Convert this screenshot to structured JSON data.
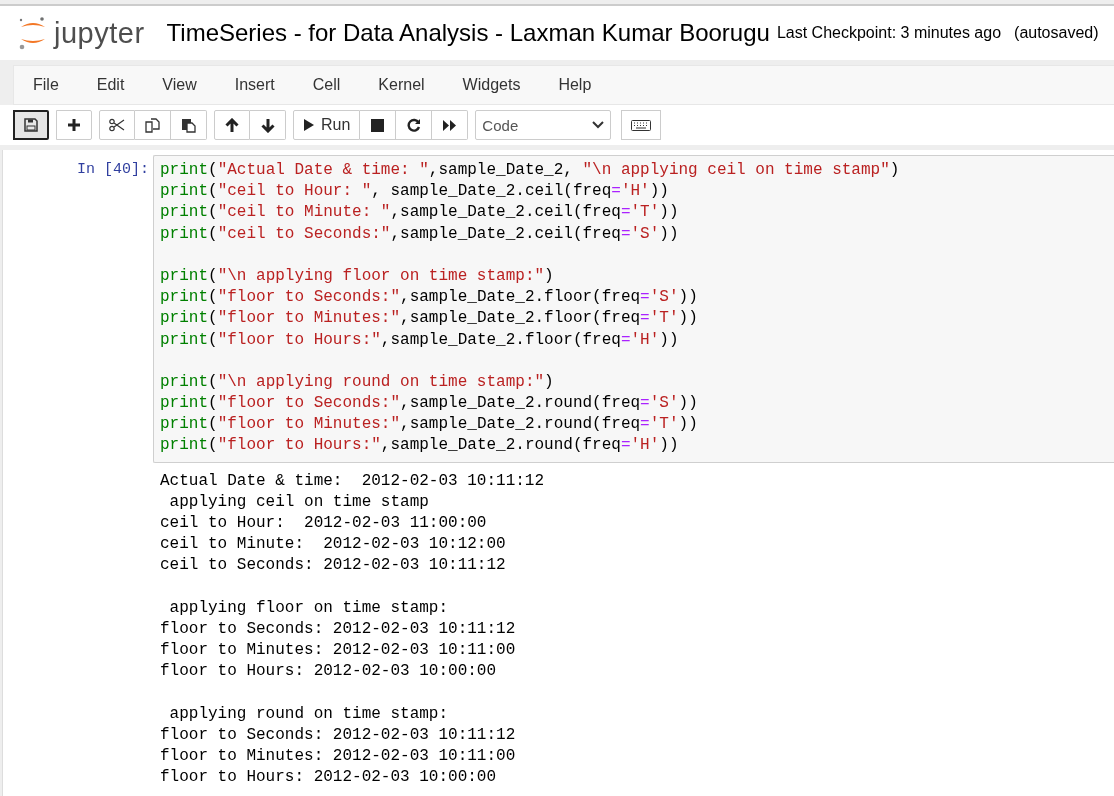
{
  "header": {
    "logo_text": "jupyter",
    "notebook_title": "TimeSeries - for Data Analysis - Laxman Kumar Boorugu",
    "checkpoint": "Last Checkpoint: 3 minutes ago",
    "autosave": "(autosaved)"
  },
  "menu": [
    "File",
    "Edit",
    "View",
    "Insert",
    "Cell",
    "Kernel",
    "Widgets",
    "Help"
  ],
  "toolbar": {
    "run_label": "Run",
    "cell_type": "Code"
  },
  "cell": {
    "prompt": "In [40]:",
    "code_blocks": [
      [
        [
          {
            "kind": "builtin",
            "text": "print"
          },
          {
            "kind": "plain",
            "text": "("
          },
          {
            "kind": "string",
            "text": "\"Actual Date & time: \""
          },
          {
            "kind": "plain",
            "text": ",sample_Date_2, "
          },
          {
            "kind": "string",
            "text": "\"\\n applying ceil on time stamp\""
          },
          {
            "kind": "plain",
            "text": ")"
          }
        ],
        [
          {
            "kind": "builtin",
            "text": "print"
          },
          {
            "kind": "plain",
            "text": "("
          },
          {
            "kind": "string",
            "text": "\"ceil to Hour: \""
          },
          {
            "kind": "plain",
            "text": ", sample_Date_2.ceil(freq"
          },
          {
            "kind": "op",
            "text": "="
          },
          {
            "kind": "string",
            "text": "'H'"
          },
          {
            "kind": "plain",
            "text": "))"
          }
        ],
        [
          {
            "kind": "builtin",
            "text": "print"
          },
          {
            "kind": "plain",
            "text": "("
          },
          {
            "kind": "string",
            "text": "\"ceil to Minute: \""
          },
          {
            "kind": "plain",
            "text": ",sample_Date_2.ceil(freq"
          },
          {
            "kind": "op",
            "text": "="
          },
          {
            "kind": "string",
            "text": "'T'"
          },
          {
            "kind": "plain",
            "text": "))"
          }
        ],
        [
          {
            "kind": "builtin",
            "text": "print"
          },
          {
            "kind": "plain",
            "text": "("
          },
          {
            "kind": "string",
            "text": "\"ceil to Seconds:\""
          },
          {
            "kind": "plain",
            "text": ",sample_Date_2.ceil(freq"
          },
          {
            "kind": "op",
            "text": "="
          },
          {
            "kind": "string",
            "text": "'S'"
          },
          {
            "kind": "plain",
            "text": "))"
          }
        ]
      ],
      [
        [
          {
            "kind": "builtin",
            "text": "print"
          },
          {
            "kind": "plain",
            "text": "("
          },
          {
            "kind": "string",
            "text": "\"\\n applying floor on time stamp:\""
          },
          {
            "kind": "plain",
            "text": ")"
          }
        ],
        [
          {
            "kind": "builtin",
            "text": "print"
          },
          {
            "kind": "plain",
            "text": "("
          },
          {
            "kind": "string",
            "text": "\"floor to Seconds:\""
          },
          {
            "kind": "plain",
            "text": ",sample_Date_2.floor(freq"
          },
          {
            "kind": "op",
            "text": "="
          },
          {
            "kind": "string",
            "text": "'S'"
          },
          {
            "kind": "plain",
            "text": "))"
          }
        ],
        [
          {
            "kind": "builtin",
            "text": "print"
          },
          {
            "kind": "plain",
            "text": "("
          },
          {
            "kind": "string",
            "text": "\"floor to Minutes:\""
          },
          {
            "kind": "plain",
            "text": ",sample_Date_2.floor(freq"
          },
          {
            "kind": "op",
            "text": "="
          },
          {
            "kind": "string",
            "text": "'T'"
          },
          {
            "kind": "plain",
            "text": "))"
          }
        ],
        [
          {
            "kind": "builtin",
            "text": "print"
          },
          {
            "kind": "plain",
            "text": "("
          },
          {
            "kind": "string",
            "text": "\"floor to Hours:\""
          },
          {
            "kind": "plain",
            "text": ",sample_Date_2.floor(freq"
          },
          {
            "kind": "op",
            "text": "="
          },
          {
            "kind": "string",
            "text": "'H'"
          },
          {
            "kind": "plain",
            "text": "))"
          }
        ]
      ],
      [
        [
          {
            "kind": "builtin",
            "text": "print"
          },
          {
            "kind": "plain",
            "text": "("
          },
          {
            "kind": "string",
            "text": "\"\\n applying round on time stamp:\""
          },
          {
            "kind": "plain",
            "text": ")"
          }
        ],
        [
          {
            "kind": "builtin",
            "text": "print"
          },
          {
            "kind": "plain",
            "text": "("
          },
          {
            "kind": "string",
            "text": "\"floor to Seconds:\""
          },
          {
            "kind": "plain",
            "text": ",sample_Date_2.round(freq"
          },
          {
            "kind": "op",
            "text": "="
          },
          {
            "kind": "string",
            "text": "'S'"
          },
          {
            "kind": "plain",
            "text": "))"
          }
        ],
        [
          {
            "kind": "builtin",
            "text": "print"
          },
          {
            "kind": "plain",
            "text": "("
          },
          {
            "kind": "string",
            "text": "\"floor to Minutes:\""
          },
          {
            "kind": "plain",
            "text": ",sample_Date_2.round(freq"
          },
          {
            "kind": "op",
            "text": "="
          },
          {
            "kind": "string",
            "text": "'T'"
          },
          {
            "kind": "plain",
            "text": "))"
          }
        ],
        [
          {
            "kind": "builtin",
            "text": "print"
          },
          {
            "kind": "plain",
            "text": "("
          },
          {
            "kind": "string",
            "text": "\"floor to Hours:\""
          },
          {
            "kind": "plain",
            "text": ",sample_Date_2.round(freq"
          },
          {
            "kind": "op",
            "text": "="
          },
          {
            "kind": "string",
            "text": "'H'"
          },
          {
            "kind": "plain",
            "text": "))"
          }
        ]
      ]
    ],
    "output_blocks": [
      [
        "Actual Date & time:  2012-02-03 10:11:12",
        " applying ceil on time stamp",
        "ceil to Hour:  2012-02-03 11:00:00",
        "ceil to Minute:  2012-02-03 10:12:00",
        "ceil to Seconds: 2012-02-03 10:11:12"
      ],
      [
        " applying floor on time stamp:",
        "floor to Seconds: 2012-02-03 10:11:12",
        "floor to Minutes: 2012-02-03 10:11:00",
        "floor to Hours: 2012-02-03 10:00:00"
      ],
      [
        " applying round on time stamp:",
        "floor to Seconds: 2012-02-03 10:11:12",
        "floor to Minutes: 2012-02-03 10:11:00",
        "floor to Hours: 2012-02-03 10:00:00"
      ]
    ]
  }
}
